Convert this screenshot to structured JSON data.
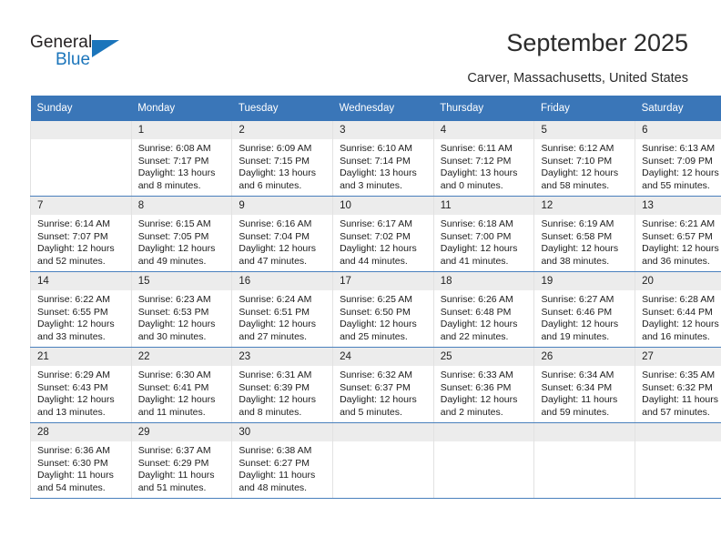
{
  "brand": {
    "name_top": "General",
    "name_bottom": "Blue",
    "accent_color": "#1b75bb",
    "triangle_icon": "triangle-icon"
  },
  "header": {
    "title": "September 2025",
    "subtitle": "Carver, Massachusetts, United States"
  },
  "calendar": {
    "header_bg": "#3a76b8",
    "daynum_bg": "#ececec",
    "weekdays": [
      "Sunday",
      "Monday",
      "Tuesday",
      "Wednesday",
      "Thursday",
      "Friday",
      "Saturday"
    ],
    "weeks": [
      [
        {
          "day": "",
          "blank": true
        },
        {
          "day": "1",
          "sunrise": "Sunrise: 6:08 AM",
          "sunset": "Sunset: 7:17 PM",
          "daylight_1": "Daylight: 13 hours",
          "daylight_2": "and 8 minutes."
        },
        {
          "day": "2",
          "sunrise": "Sunrise: 6:09 AM",
          "sunset": "Sunset: 7:15 PM",
          "daylight_1": "Daylight: 13 hours",
          "daylight_2": "and 6 minutes."
        },
        {
          "day": "3",
          "sunrise": "Sunrise: 6:10 AM",
          "sunset": "Sunset: 7:14 PM",
          "daylight_1": "Daylight: 13 hours",
          "daylight_2": "and 3 minutes."
        },
        {
          "day": "4",
          "sunrise": "Sunrise: 6:11 AM",
          "sunset": "Sunset: 7:12 PM",
          "daylight_1": "Daylight: 13 hours",
          "daylight_2": "and 0 minutes."
        },
        {
          "day": "5",
          "sunrise": "Sunrise: 6:12 AM",
          "sunset": "Sunset: 7:10 PM",
          "daylight_1": "Daylight: 12 hours",
          "daylight_2": "and 58 minutes."
        },
        {
          "day": "6",
          "sunrise": "Sunrise: 6:13 AM",
          "sunset": "Sunset: 7:09 PM",
          "daylight_1": "Daylight: 12 hours",
          "daylight_2": "and 55 minutes."
        }
      ],
      [
        {
          "day": "7",
          "sunrise": "Sunrise: 6:14 AM",
          "sunset": "Sunset: 7:07 PM",
          "daylight_1": "Daylight: 12 hours",
          "daylight_2": "and 52 minutes."
        },
        {
          "day": "8",
          "sunrise": "Sunrise: 6:15 AM",
          "sunset": "Sunset: 7:05 PM",
          "daylight_1": "Daylight: 12 hours",
          "daylight_2": "and 49 minutes."
        },
        {
          "day": "9",
          "sunrise": "Sunrise: 6:16 AM",
          "sunset": "Sunset: 7:04 PM",
          "daylight_1": "Daylight: 12 hours",
          "daylight_2": "and 47 minutes."
        },
        {
          "day": "10",
          "sunrise": "Sunrise: 6:17 AM",
          "sunset": "Sunset: 7:02 PM",
          "daylight_1": "Daylight: 12 hours",
          "daylight_2": "and 44 minutes."
        },
        {
          "day": "11",
          "sunrise": "Sunrise: 6:18 AM",
          "sunset": "Sunset: 7:00 PM",
          "daylight_1": "Daylight: 12 hours",
          "daylight_2": "and 41 minutes."
        },
        {
          "day": "12",
          "sunrise": "Sunrise: 6:19 AM",
          "sunset": "Sunset: 6:58 PM",
          "daylight_1": "Daylight: 12 hours",
          "daylight_2": "and 38 minutes."
        },
        {
          "day": "13",
          "sunrise": "Sunrise: 6:21 AM",
          "sunset": "Sunset: 6:57 PM",
          "daylight_1": "Daylight: 12 hours",
          "daylight_2": "and 36 minutes."
        }
      ],
      [
        {
          "day": "14",
          "sunrise": "Sunrise: 6:22 AM",
          "sunset": "Sunset: 6:55 PM",
          "daylight_1": "Daylight: 12 hours",
          "daylight_2": "and 33 minutes."
        },
        {
          "day": "15",
          "sunrise": "Sunrise: 6:23 AM",
          "sunset": "Sunset: 6:53 PM",
          "daylight_1": "Daylight: 12 hours",
          "daylight_2": "and 30 minutes."
        },
        {
          "day": "16",
          "sunrise": "Sunrise: 6:24 AM",
          "sunset": "Sunset: 6:51 PM",
          "daylight_1": "Daylight: 12 hours",
          "daylight_2": "and 27 minutes."
        },
        {
          "day": "17",
          "sunrise": "Sunrise: 6:25 AM",
          "sunset": "Sunset: 6:50 PM",
          "daylight_1": "Daylight: 12 hours",
          "daylight_2": "and 25 minutes."
        },
        {
          "day": "18",
          "sunrise": "Sunrise: 6:26 AM",
          "sunset": "Sunset: 6:48 PM",
          "daylight_1": "Daylight: 12 hours",
          "daylight_2": "and 22 minutes."
        },
        {
          "day": "19",
          "sunrise": "Sunrise: 6:27 AM",
          "sunset": "Sunset: 6:46 PM",
          "daylight_1": "Daylight: 12 hours",
          "daylight_2": "and 19 minutes."
        },
        {
          "day": "20",
          "sunrise": "Sunrise: 6:28 AM",
          "sunset": "Sunset: 6:44 PM",
          "daylight_1": "Daylight: 12 hours",
          "daylight_2": "and 16 minutes."
        }
      ],
      [
        {
          "day": "21",
          "sunrise": "Sunrise: 6:29 AM",
          "sunset": "Sunset: 6:43 PM",
          "daylight_1": "Daylight: 12 hours",
          "daylight_2": "and 13 minutes."
        },
        {
          "day": "22",
          "sunrise": "Sunrise: 6:30 AM",
          "sunset": "Sunset: 6:41 PM",
          "daylight_1": "Daylight: 12 hours",
          "daylight_2": "and 11 minutes."
        },
        {
          "day": "23",
          "sunrise": "Sunrise: 6:31 AM",
          "sunset": "Sunset: 6:39 PM",
          "daylight_1": "Daylight: 12 hours",
          "daylight_2": "and 8 minutes."
        },
        {
          "day": "24",
          "sunrise": "Sunrise: 6:32 AM",
          "sunset": "Sunset: 6:37 PM",
          "daylight_1": "Daylight: 12 hours",
          "daylight_2": "and 5 minutes."
        },
        {
          "day": "25",
          "sunrise": "Sunrise: 6:33 AM",
          "sunset": "Sunset: 6:36 PM",
          "daylight_1": "Daylight: 12 hours",
          "daylight_2": "and 2 minutes."
        },
        {
          "day": "26",
          "sunrise": "Sunrise: 6:34 AM",
          "sunset": "Sunset: 6:34 PM",
          "daylight_1": "Daylight: 11 hours",
          "daylight_2": "and 59 minutes."
        },
        {
          "day": "27",
          "sunrise": "Sunrise: 6:35 AM",
          "sunset": "Sunset: 6:32 PM",
          "daylight_1": "Daylight: 11 hours",
          "daylight_2": "and 57 minutes."
        }
      ],
      [
        {
          "day": "28",
          "sunrise": "Sunrise: 6:36 AM",
          "sunset": "Sunset: 6:30 PM",
          "daylight_1": "Daylight: 11 hours",
          "daylight_2": "and 54 minutes."
        },
        {
          "day": "29",
          "sunrise": "Sunrise: 6:37 AM",
          "sunset": "Sunset: 6:29 PM",
          "daylight_1": "Daylight: 11 hours",
          "daylight_2": "and 51 minutes."
        },
        {
          "day": "30",
          "sunrise": "Sunrise: 6:38 AM",
          "sunset": "Sunset: 6:27 PM",
          "daylight_1": "Daylight: 11 hours",
          "daylight_2": "and 48 minutes."
        },
        {
          "day": "",
          "blank": true
        },
        {
          "day": "",
          "blank": true
        },
        {
          "day": "",
          "blank": true
        },
        {
          "day": "",
          "blank": true
        }
      ]
    ]
  }
}
